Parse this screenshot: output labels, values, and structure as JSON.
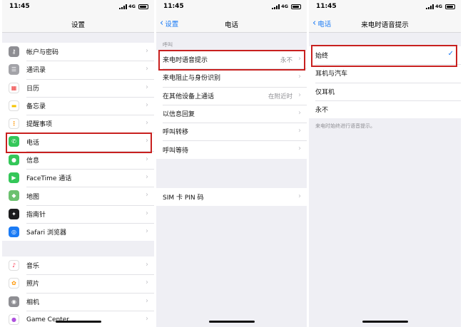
{
  "status": {
    "time": "11:45",
    "network": "4G"
  },
  "settings": {
    "title": "设置",
    "group1": [
      {
        "label": "帐户与密码",
        "icon": "key-icon",
        "color": "#8e8e93"
      },
      {
        "label": "通讯录",
        "icon": "contacts-icon",
        "color": "#a3a3a8"
      },
      {
        "label": "日历",
        "icon": "calendar-icon",
        "color": "#ffffff"
      },
      {
        "label": "备忘录",
        "icon": "notes-icon",
        "color": "#ffffff"
      },
      {
        "label": "提醒事项",
        "icon": "reminders-icon",
        "color": "#ffffff"
      },
      {
        "label": "电话",
        "icon": "phone-icon",
        "color": "#34c759"
      },
      {
        "label": "信息",
        "icon": "messages-icon",
        "color": "#34c759"
      },
      {
        "label": "FaceTime 通话",
        "icon": "facetime-icon",
        "color": "#34c759"
      },
      {
        "label": "地图",
        "icon": "maps-icon",
        "color": "#6cc16f"
      },
      {
        "label": "指南针",
        "icon": "compass-icon",
        "color": "#1c1c1e"
      },
      {
        "label": "Safari 浏览器",
        "icon": "safari-icon",
        "color": "#1b7bf5"
      }
    ],
    "group2": [
      {
        "label": "音乐",
        "icon": "music-icon",
        "color": "#ffffff"
      },
      {
        "label": "照片",
        "icon": "photos-icon",
        "color": "#ffffff"
      },
      {
        "label": "相机",
        "icon": "camera-icon",
        "color": "#8e8e93"
      },
      {
        "label": "Game Center",
        "icon": "game-center-icon",
        "color": "#ffffff"
      }
    ]
  },
  "phone": {
    "back": "设置",
    "title": "电话",
    "section_header": "呼叫",
    "group1": [
      {
        "label": "来电时语音提示",
        "value": "永不"
      },
      {
        "label": "来电阻止与身份识别",
        "value": ""
      },
      {
        "label": "在其他设备上通话",
        "value": "在附近时"
      },
      {
        "label": "以信息回复",
        "value": ""
      },
      {
        "label": "呼叫转移",
        "value": ""
      },
      {
        "label": "呼叫等待",
        "value": ""
      }
    ],
    "group2": [
      {
        "label": "SIM 卡 PIN 码",
        "value": ""
      }
    ]
  },
  "announce": {
    "back": "电话",
    "title": "来电时语音提示",
    "options": [
      {
        "label": "始终",
        "selected": true
      },
      {
        "label": "耳机与汽车",
        "selected": false
      },
      {
        "label": "仅耳机",
        "selected": false
      },
      {
        "label": "永不",
        "selected": false
      }
    ],
    "footer": "来电时始终进行语音提示。"
  }
}
